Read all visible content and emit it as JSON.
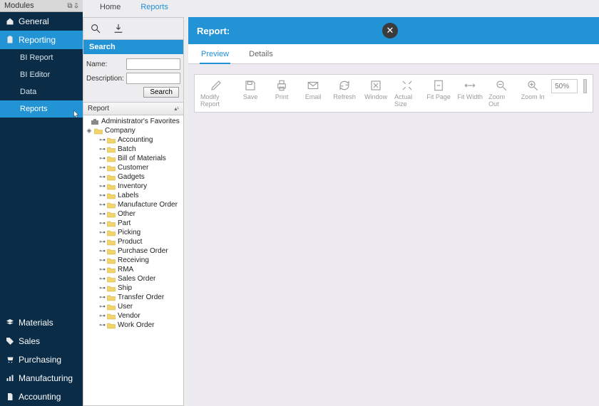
{
  "sidebar": {
    "header": "Modules",
    "modules": [
      {
        "label": "General",
        "icon": "home"
      },
      {
        "label": "Reporting",
        "icon": "clipboard",
        "active": true,
        "items": [
          {
            "label": "BI Report"
          },
          {
            "label": "BI Editor"
          },
          {
            "label": "Data"
          },
          {
            "label": "Reports",
            "active": true
          }
        ]
      }
    ],
    "bottom_modules": [
      {
        "label": "Materials",
        "icon": "layers"
      },
      {
        "label": "Sales",
        "icon": "tag"
      },
      {
        "label": "Purchasing",
        "icon": "cart"
      },
      {
        "label": "Manufacturing",
        "icon": "bars"
      },
      {
        "label": "Accounting",
        "icon": "doc"
      }
    ]
  },
  "breadcrumb": {
    "home": "Home",
    "reports": "Reports"
  },
  "search_panel": {
    "title": "Search",
    "name_label": "Name:",
    "description_label": "Description:",
    "search_button": "Search"
  },
  "tree": {
    "header": "Report",
    "root": {
      "label": "Administrator's Favorites"
    },
    "company": {
      "label": "Company"
    },
    "children": [
      "Accounting",
      "Batch",
      "Bill of Materials",
      "Customer",
      "Gadgets",
      "Inventory",
      "Labels",
      "Manufacture Order",
      "Other",
      "Part",
      "Picking",
      "Product",
      "Purchase Order",
      "Receiving",
      "RMA",
      "Sales Order",
      "Ship",
      "Transfer Order",
      "User",
      "Vendor",
      "Work Order"
    ]
  },
  "viewer": {
    "title": "Report:",
    "tabs": {
      "preview": "Preview",
      "details": "Details"
    },
    "toolbar": {
      "modify": "Modify Report",
      "save": "Save",
      "print": "Print",
      "email": "Email",
      "refresh": "Refresh",
      "window": "Window",
      "actual_size": "Actual Size",
      "fit_page": "Fit Page",
      "fit_width": "Fit Width",
      "zoom_out": "Zoom Out",
      "zoom_in": "Zoom In",
      "zoom_value": "50%"
    }
  }
}
